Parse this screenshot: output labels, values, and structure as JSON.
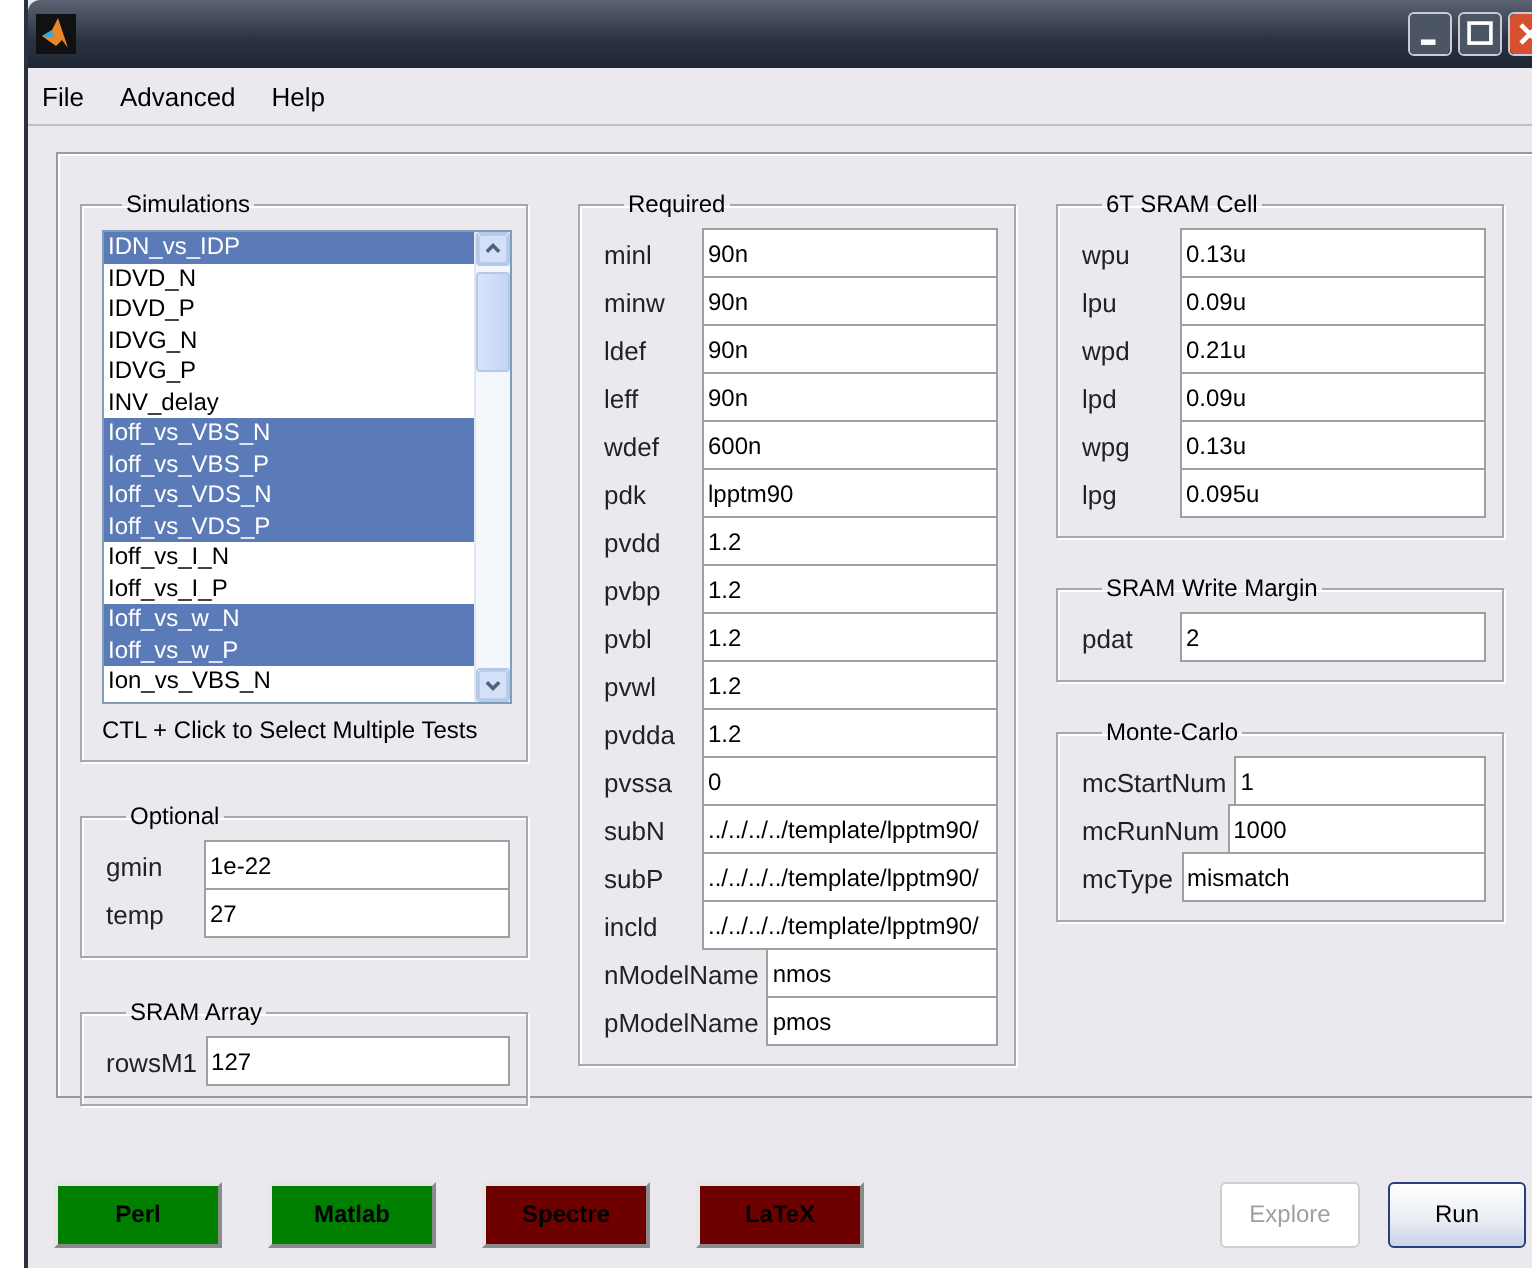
{
  "menu": [
    "File",
    "Advanced",
    "Help"
  ],
  "columns": [
    [
      {
        "kind": "list",
        "title": "Simulations",
        "items": [
          {
            "label": "IDN_vs_IDP",
            "selected": true
          },
          {
            "label": "IDVD_N",
            "selected": false
          },
          {
            "label": "IDVD_P",
            "selected": false
          },
          {
            "label": "IDVG_N",
            "selected": false
          },
          {
            "label": "IDVG_P",
            "selected": false
          },
          {
            "label": "INV_delay",
            "selected": false
          },
          {
            "label": "Ioff_vs_VBS_N",
            "selected": true
          },
          {
            "label": "Ioff_vs_VBS_P",
            "selected": true
          },
          {
            "label": "Ioff_vs_VDS_N",
            "selected": true
          },
          {
            "label": "Ioff_vs_VDS_P",
            "selected": true
          },
          {
            "label": "Ioff_vs_I_N",
            "selected": false
          },
          {
            "label": "Ioff_vs_I_P",
            "selected": false
          },
          {
            "label": "Ioff_vs_w_N",
            "selected": true
          },
          {
            "label": "Ioff_vs_w_P",
            "selected": true
          },
          {
            "label": "Ion_vs_VBS_N",
            "selected": false
          }
        ],
        "hint": "CTL + Click to Select Multiple Tests"
      },
      {
        "kind": "fields",
        "title": "Optional",
        "fields": [
          {
            "label": "gmin",
            "value": "1e-22"
          },
          {
            "label": "temp",
            "value": "27"
          }
        ]
      },
      {
        "kind": "fields",
        "title": "SRAM Array",
        "fields": [
          {
            "label": "rowsM1",
            "value": "127"
          }
        ]
      }
    ],
    [
      {
        "kind": "fields",
        "title": "Required",
        "fields": [
          {
            "label": "minl",
            "value": "90n"
          },
          {
            "label": "minw",
            "value": "90n"
          },
          {
            "label": "ldef",
            "value": "90n"
          },
          {
            "label": "leff",
            "value": "90n"
          },
          {
            "label": "wdef",
            "value": "600n"
          },
          {
            "label": "pdk",
            "value": "lpptm90"
          },
          {
            "label": "pvdd",
            "value": "1.2"
          },
          {
            "label": "pvbp",
            "value": "1.2"
          },
          {
            "label": "pvbl",
            "value": "1.2"
          },
          {
            "label": "pvwl",
            "value": "1.2"
          },
          {
            "label": "pvdda",
            "value": "1.2"
          },
          {
            "label": "pvssa",
            "value": "0"
          },
          {
            "label": "subN",
            "value": "../../../../template/lpptm90/"
          },
          {
            "label": "subP",
            "value": "../../../../template/lpptm90/"
          },
          {
            "label": "incld",
            "value": "../../../../template/lpptm90/"
          },
          {
            "label": "nModelName",
            "value": "nmos"
          },
          {
            "label": "pModelName",
            "value": "pmos"
          }
        ]
      }
    ],
    [
      {
        "kind": "fields",
        "title": "6T SRAM Cell",
        "fields": [
          {
            "label": "wpu",
            "value": "0.13u"
          },
          {
            "label": "lpu",
            "value": "0.09u"
          },
          {
            "label": "wpd",
            "value": "0.21u"
          },
          {
            "label": "lpd",
            "value": "0.09u"
          },
          {
            "label": "wpg",
            "value": "0.13u"
          },
          {
            "label": "lpg",
            "value": "0.095u"
          }
        ]
      },
      {
        "kind": "fields",
        "title": "SRAM Write Margin",
        "fields": [
          {
            "label": "pdat",
            "value": "2"
          }
        ]
      },
      {
        "kind": "fields",
        "title": "Monte-Carlo",
        "fields": [
          {
            "label": "mcStartNum",
            "value": "1"
          },
          {
            "label": "mcRunNum",
            "value": "1000"
          },
          {
            "label": "mcType",
            "value": "mismatch"
          }
        ]
      }
    ]
  ],
  "tool_buttons": [
    {
      "label": "Perl",
      "color": "#007f00"
    },
    {
      "label": "Matlab",
      "color": "#007f00"
    },
    {
      "label": "Spectre",
      "color": "#6f0000"
    },
    {
      "label": "LaTeX",
      "color": "#6f0000"
    }
  ],
  "action_buttons": [
    {
      "label": "Explore",
      "disabled": true
    },
    {
      "label": "Run",
      "disabled": false
    }
  ]
}
